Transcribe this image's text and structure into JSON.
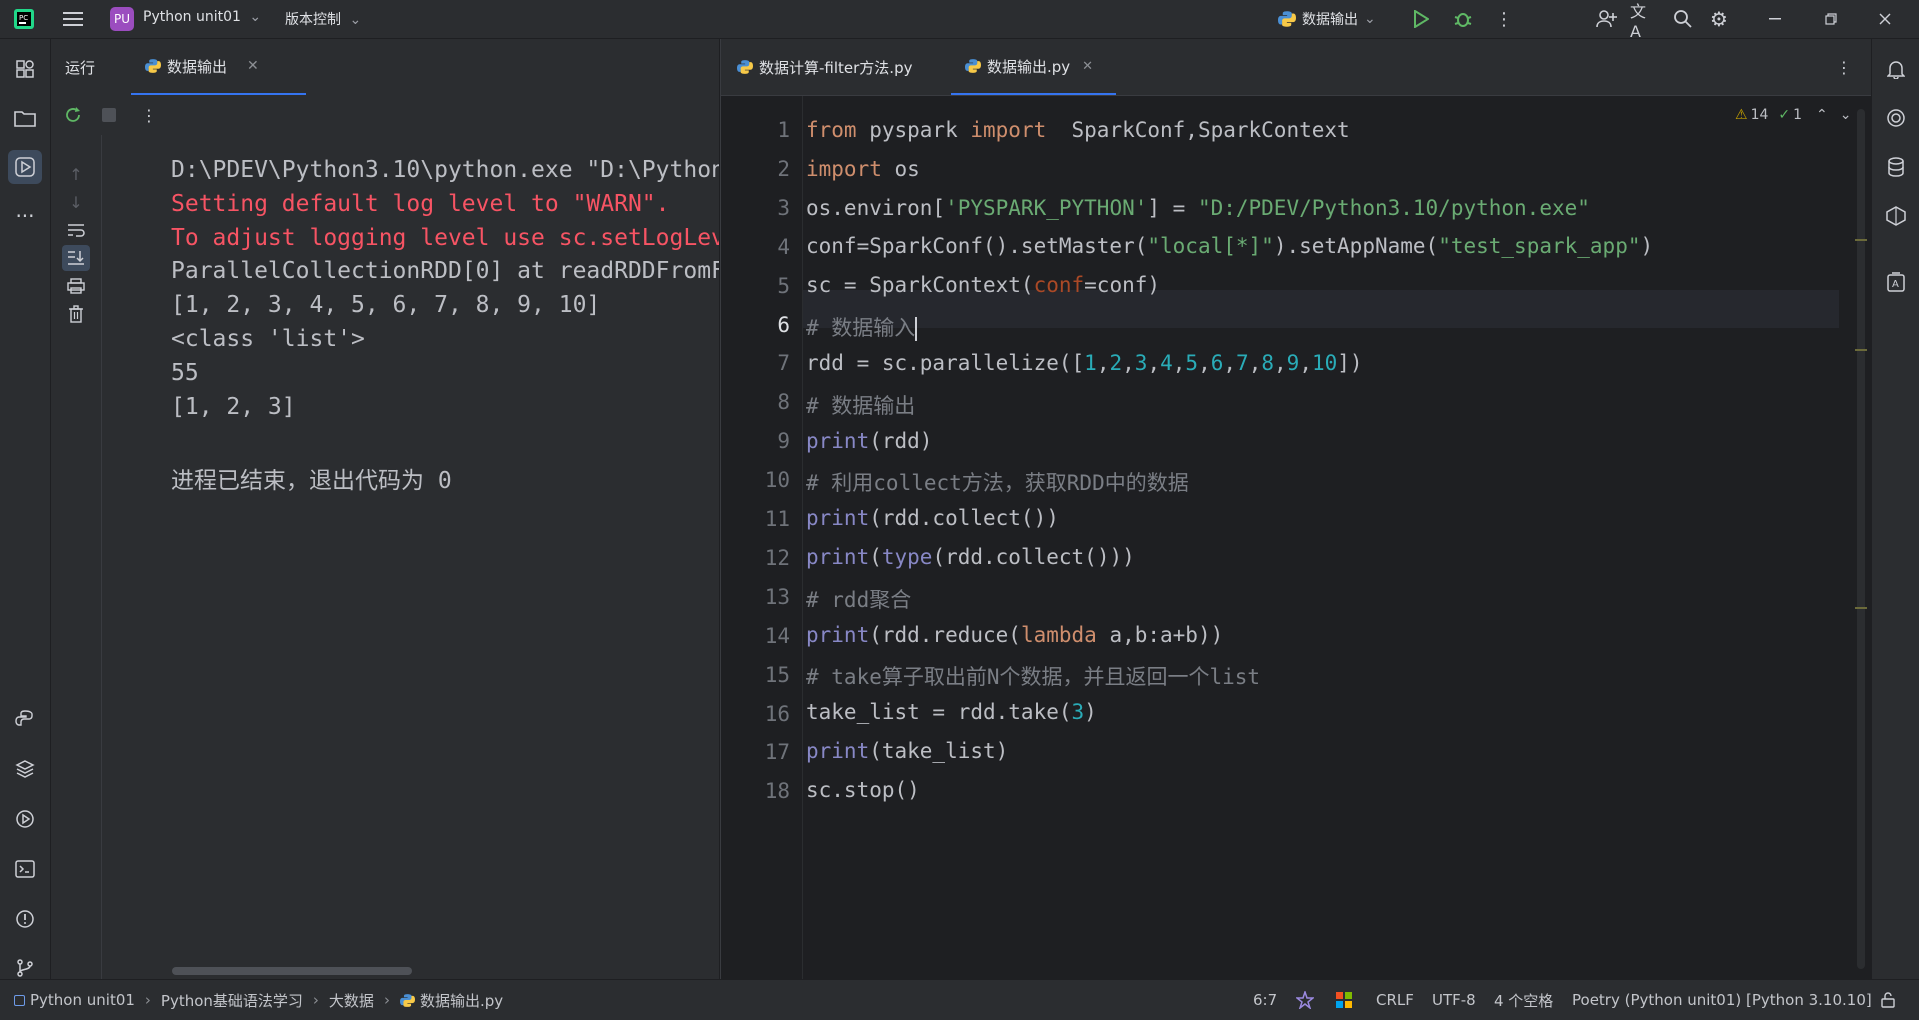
{
  "titlebar": {
    "project_badge": "PU",
    "project_name": "Python unit01",
    "vcs_menu": "版本控制",
    "run_config": "数据输出"
  },
  "run_panel": {
    "tab_run": "运行",
    "tab_config": "数据输出",
    "console_lines": [
      {
        "text": "D:\\PDEV\\Python3.10\\python.exe \"D:\\Python",
        "type": "normal"
      },
      {
        "text": "Setting default log level to \"WARN\".",
        "type": "error"
      },
      {
        "text": "To adjust logging level use sc.setLogLev",
        "type": "error"
      },
      {
        "text": "ParallelCollectionRDD[0] at readRDDFromF",
        "type": "normal"
      },
      {
        "text": "[1, 2, 3, 4, 5, 6, 7, 8, 9, 10]",
        "type": "normal"
      },
      {
        "text": "<class 'list'>",
        "type": "normal"
      },
      {
        "text": "55",
        "type": "normal"
      },
      {
        "text": "[1, 2, 3]",
        "type": "normal"
      },
      {
        "text": "",
        "type": "normal"
      },
      {
        "text": "进程已结束，退出代码为 0",
        "type": "normal"
      }
    ]
  },
  "editor": {
    "tabs": [
      {
        "label": "数据计算-filter方法.py",
        "active": false
      },
      {
        "label": "数据输出.py",
        "active": true
      }
    ],
    "warnings_count": "14",
    "ok_count": "1",
    "lines": [
      "1",
      "2",
      "3",
      "4",
      "5",
      "6",
      "7",
      "8",
      "9",
      "10",
      "11",
      "12",
      "13",
      "14",
      "15",
      "16",
      "17",
      "18"
    ]
  },
  "statusbar": {
    "breadcrumb": [
      "Python unit01",
      "Python基础语法学习",
      "大数据",
      "数据输出.py"
    ],
    "position": "6:7",
    "line_sep": "CRLF",
    "encoding": "UTF-8",
    "indent": "4 个空格",
    "interpreter": "Poetry (Python unit01) [Python 3.10.10]"
  },
  "colors": {
    "bg": "#1e1f22",
    "panel": "#2b2d30",
    "keyword": "#cf8e6d",
    "string": "#6aab73",
    "number": "#2aacb8",
    "error_text": "#f75464",
    "run_green": "#5fb865"
  }
}
